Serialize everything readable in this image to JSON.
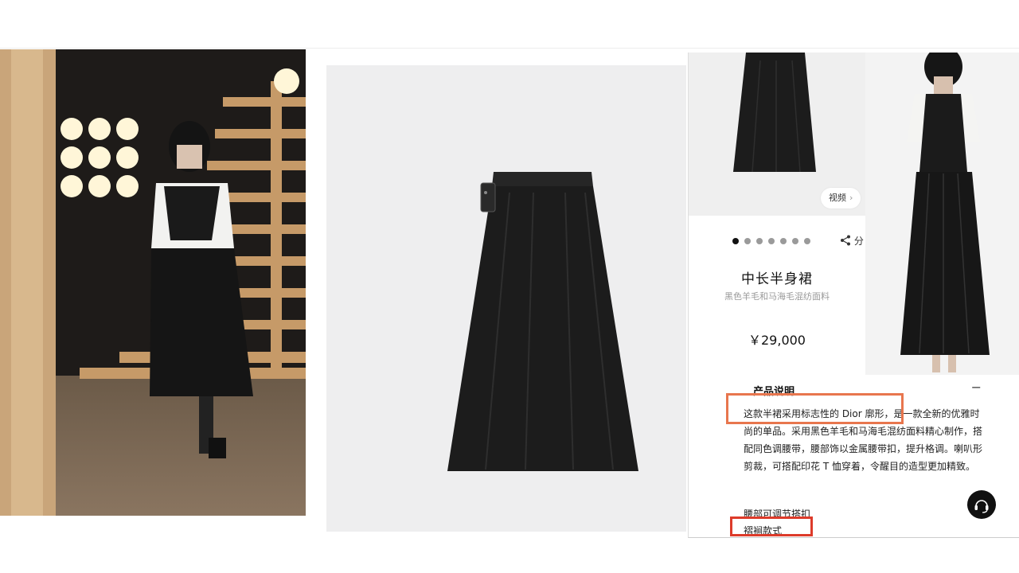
{
  "product": {
    "name": "中长半身裙",
    "subtitle": "黑色羊毛和马海毛混纺面料",
    "price": "￥29,000",
    "video_label": "视频",
    "share_label": "分",
    "gallery_dot_count": 7
  },
  "description": {
    "title": "产品说明",
    "collapse_icon": "minus-icon",
    "body": "这款半裙采用标志性的 Dior 廓形，是一款全新的优雅时尚的单品。采用黑色羊毛和马海毛混纺面料精心制作，搭配同色调腰带，腰部饰以金属腰带扣，提升格调。喇叭形剪裁，可搭配印花 T 恤穿着，令醒目的造型更加精致。",
    "feature_1": "腰部可调节搭扣",
    "feature_2": "褶裥款式"
  },
  "icons": {
    "share": "share-icon",
    "customer_service": "headset-icon",
    "video_chevron": "chevron-right-icon"
  },
  "colors": {
    "highlight_orange": "#e8764e",
    "highlight_red": "#dd3b2a",
    "skirt": "#1a1a1a"
  }
}
